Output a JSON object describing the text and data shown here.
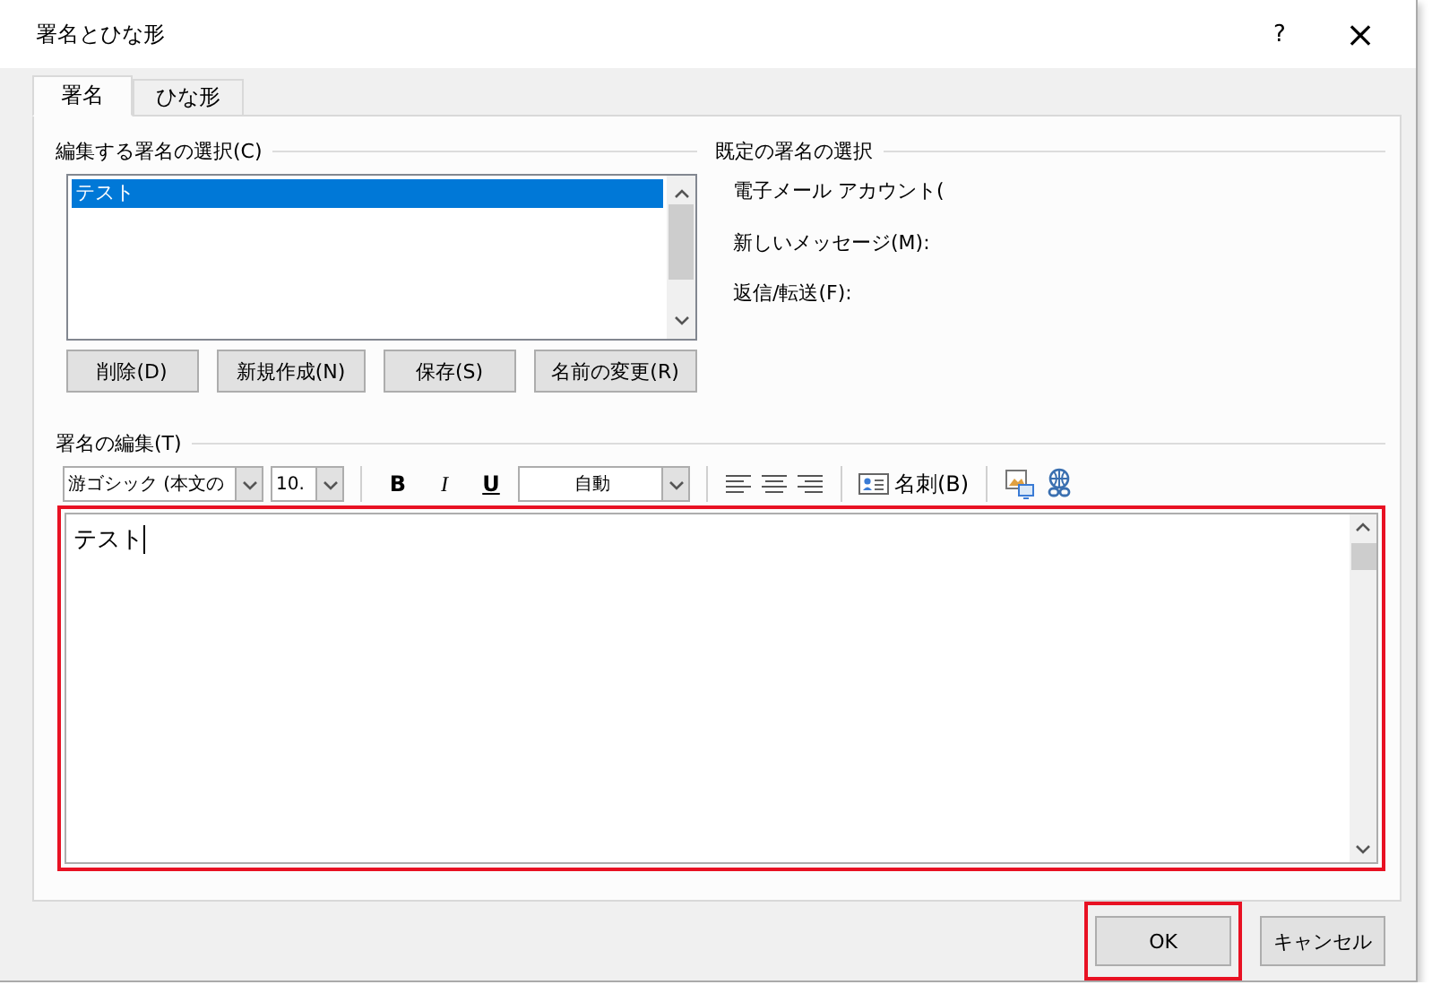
{
  "window": {
    "title": "署名とひな形",
    "help": "?",
    "close": "×"
  },
  "tabs": [
    {
      "label": "署名",
      "selected": true
    },
    {
      "label": "ひな形",
      "selected": false
    }
  ],
  "signature_select": {
    "label": "編集する署名の選択(C)",
    "items": [
      {
        "label": "テスト",
        "selected": true
      }
    ],
    "buttons": [
      "削除(D)",
      "新規作成(N)",
      "保存(S)",
      "名前の変更(R)"
    ]
  },
  "default_signature": {
    "label": "既定の署名の選択",
    "fields": [
      {
        "label": "電子メール アカウント("
      },
      {
        "label": "新しいメッセージ(M):"
      },
      {
        "label": "返信/転送(F):"
      }
    ]
  },
  "editor": {
    "label": "署名の編集(T)",
    "toolbar": {
      "font": "游ゴシック (本文の",
      "size": "10.",
      "bold": "B",
      "italic": "I",
      "underline": "U",
      "font_color": "自動",
      "business_card": "名刺(B)"
    },
    "text": "テスト",
    "highlighted": true
  },
  "buttons": [
    {
      "label": "OK",
      "highlighted": true
    },
    {
      "label": "キャンセル",
      "highlighted": false
    }
  ]
}
